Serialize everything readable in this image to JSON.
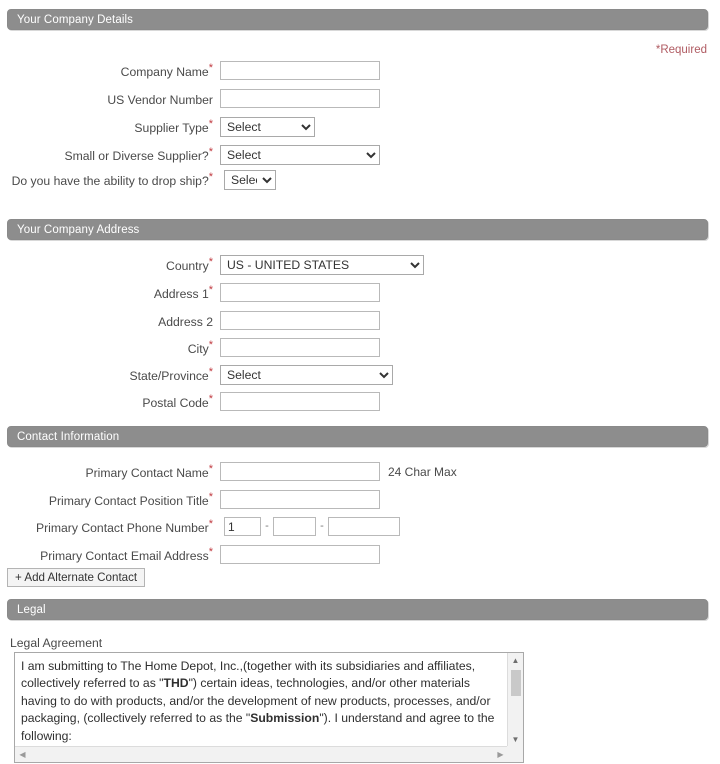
{
  "required_note": "*Required",
  "sections": [
    {
      "title": "Your Company Details"
    },
    {
      "title": "Your Company Address"
    },
    {
      "title": "Contact Information"
    },
    {
      "title": "Legal"
    }
  ],
  "company_details": {
    "fields": [
      {
        "label": "Company Name",
        "required": true,
        "type": "text",
        "value": ""
      },
      {
        "label": "US Vendor Number",
        "required": false,
        "type": "text",
        "value": ""
      },
      {
        "label": "Supplier Type",
        "required": true,
        "type": "select",
        "value": "Select"
      },
      {
        "label": "Small or Diverse Supplier?",
        "required": true,
        "type": "select",
        "value": "Select"
      },
      {
        "label": "Do you have the ability to drop ship?",
        "required": true,
        "type": "select",
        "value": "Select"
      }
    ]
  },
  "company_address": {
    "fields": [
      {
        "label": "Country",
        "required": true,
        "type": "select",
        "value": "US - UNITED STATES"
      },
      {
        "label": "Address 1",
        "required": true,
        "type": "text",
        "value": ""
      },
      {
        "label": "Address 2",
        "required": false,
        "type": "text",
        "value": ""
      },
      {
        "label": "City",
        "required": true,
        "type": "text",
        "value": ""
      },
      {
        "label": "State/Province",
        "required": true,
        "type": "select",
        "value": "Select"
      },
      {
        "label": "Postal Code",
        "required": true,
        "type": "text",
        "value": ""
      }
    ]
  },
  "contact_information": {
    "fields": [
      {
        "label": "Primary Contact Name",
        "required": true,
        "type": "text",
        "value": "",
        "hint": "24 Char Max"
      },
      {
        "label": "Primary Contact Position Title",
        "required": true,
        "type": "text",
        "value": ""
      },
      {
        "label": "Primary Contact Phone Number",
        "required": true,
        "type": "phone",
        "value_country": "1",
        "value_area": "",
        "value_number": "",
        "separator": "-"
      },
      {
        "label": "Primary Contact Email Address",
        "required": true,
        "type": "text",
        "value": ""
      }
    ],
    "add_alternate_button": "+ Add Alternate Contact"
  },
  "legal": {
    "label": "Legal Agreement",
    "text_parts": [
      {
        "text": "I am submitting to The Home Depot, Inc.,(together with its subsidiaries and affiliates, collectively referred to as \"",
        "bold": false
      },
      {
        "text": "THD",
        "bold": true
      },
      {
        "text": "\") certain ideas, technologies, and/or other materials having to do with products, and/or the development of new products, processes, and/or packaging, (collectively referred to as the \"",
        "bold": false
      },
      {
        "text": "Submission",
        "bold": true
      },
      {
        "text": "\"). I understand and agree to the following:",
        "bold": false
      }
    ],
    "scrollbar": {
      "up_arrow": "▲",
      "down_arrow": "▼",
      "left_arrow": "◀",
      "right_arrow": "▶"
    }
  },
  "colors": {
    "section_bar": "#8d8d8d",
    "required_text": "#b05c63",
    "asterisk": "#c0393f",
    "label_text": "#4a4a4a",
    "page_background": "#ffffff"
  }
}
